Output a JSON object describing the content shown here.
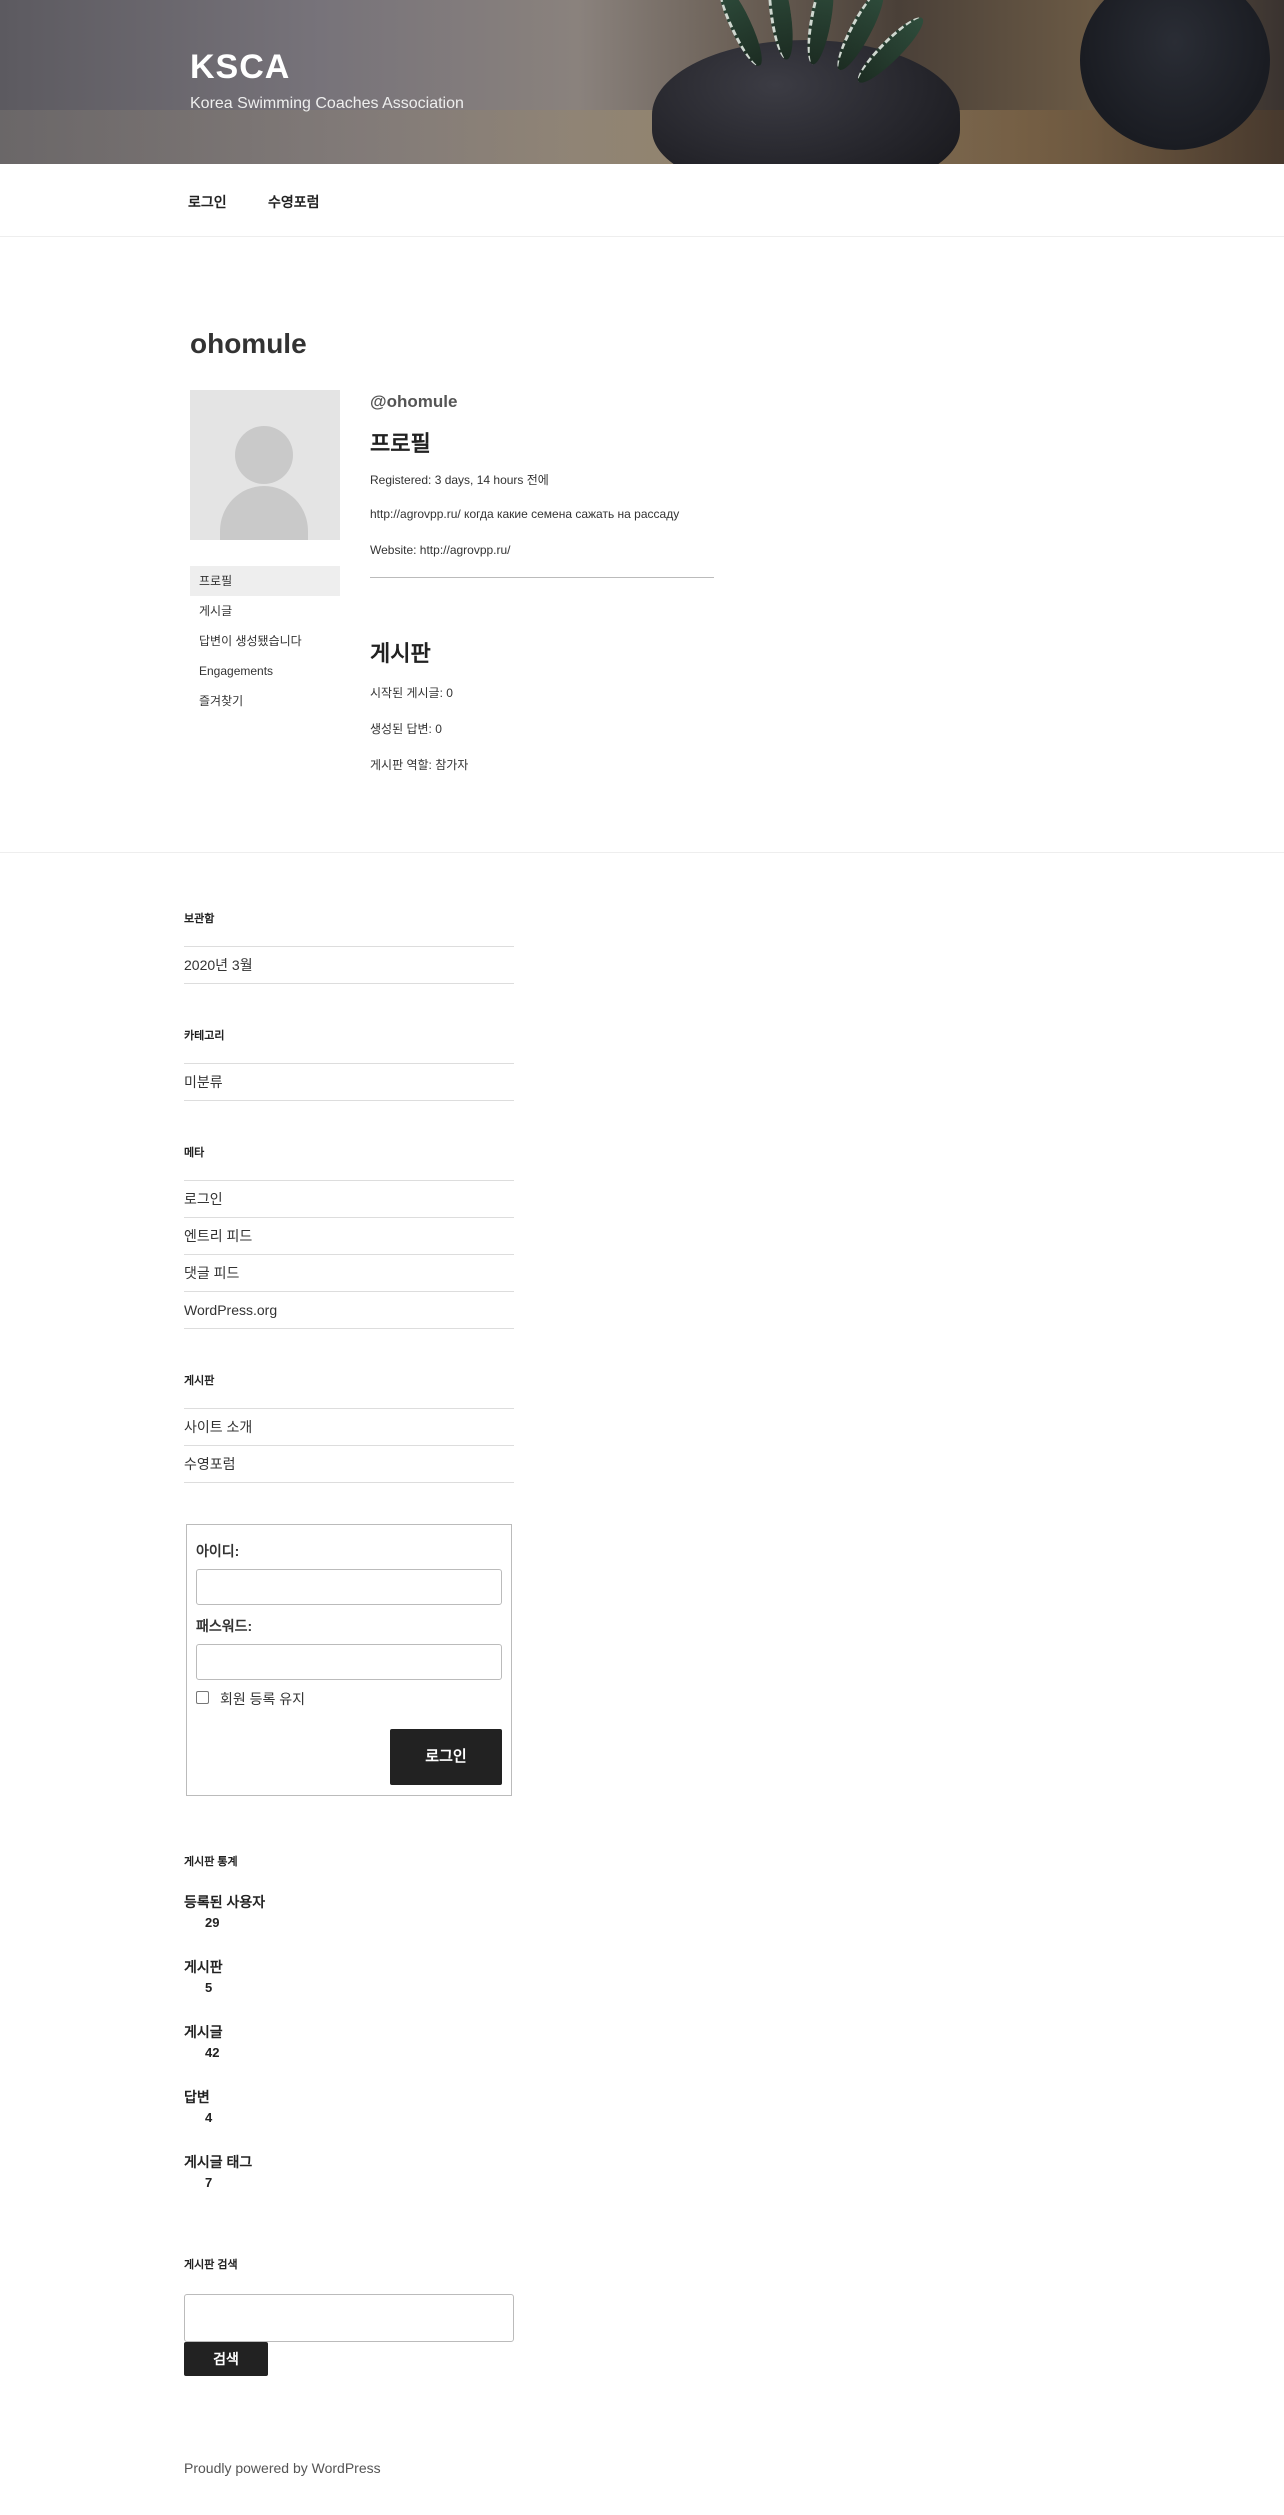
{
  "site": {
    "title": "KSCA",
    "description": "Korea Swimming Coaches Association"
  },
  "nav": {
    "items": [
      "로그인",
      "수영포럼"
    ]
  },
  "profile": {
    "page_title": "ohomule",
    "handle": "@ohomule",
    "menu": [
      "프로필",
      "게시글",
      "답변이 생성됐습니다",
      "Engagements",
      "즐겨찾기"
    ],
    "section_title": "프로필",
    "registered": "Registered: 3 days, 14 hours 전에",
    "bio": "http://agrovpp.ru/ когда какие семена сажать на рассаду",
    "website": "Website: http://agrovpp.ru/",
    "forum_title": "게시판",
    "topics_started": "시작된 게시글: 0",
    "replies_created": "생성된 답변: 0",
    "forum_role": "게시판 역할: 참가자"
  },
  "sidebar": {
    "archives": {
      "title": "보관함",
      "items": [
        "2020년 3월"
      ]
    },
    "categories": {
      "title": "카테고리",
      "items": [
        "미분류"
      ]
    },
    "meta": {
      "title": "메타",
      "items": [
        "로그인",
        "엔트리 피드",
        "댓글 피드",
        "WordPress.org"
      ]
    },
    "forums": {
      "title": "게시판",
      "items": [
        "사이트 소개",
        "수영포럼"
      ]
    },
    "login": {
      "username_label": "아이디:",
      "password_label": "패스워드:",
      "remember_label": "회원 등록 유지",
      "button": "로그인"
    },
    "stats": {
      "title": "게시판 통계",
      "items": [
        {
          "label": "등록된 사용자",
          "value": "29"
        },
        {
          "label": "게시판",
          "value": "5"
        },
        {
          "label": "게시글",
          "value": "42"
        },
        {
          "label": "답변",
          "value": "4"
        },
        {
          "label": "게시글 태그",
          "value": "7"
        }
      ]
    },
    "search": {
      "title": "게시판 검색",
      "button": "검색"
    }
  },
  "footer": {
    "text": "Proudly powered by WordPress"
  }
}
